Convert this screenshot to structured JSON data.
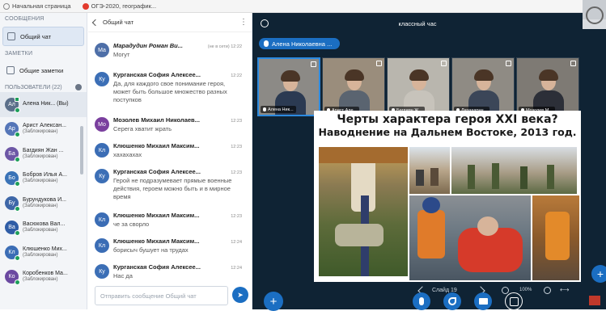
{
  "bookmarks": [
    {
      "label": "Начальная страница",
      "icon": "home-icon"
    },
    {
      "label": "ОГЭ-2020, географик...",
      "icon": "site-icon"
    }
  ],
  "sidebar": {
    "messages_section": "СООБЩЕНИЯ",
    "public_chat": "Общий чат",
    "notes_section": "ЗАМЕТКИ",
    "shared_notes": "Общие заметки",
    "users_section": "ПОЛЬЗОВАТЕЛИ (22)",
    "users": [
      {
        "initials": "Ал",
        "name": "Алена Ник... (Вы)",
        "status": "",
        "color": "#5b6f8a"
      },
      {
        "initials": "Ар",
        "name": "Арист Алексан...",
        "status": "(Заблокирован)",
        "color": "#5576b8"
      },
      {
        "initials": "Ба",
        "name": "Багдиян Жан ...",
        "status": "(Заблокирован)",
        "color": "#6d57a6"
      },
      {
        "initials": "Бо",
        "name": "Бобров Илья А...",
        "status": "(Заблокирован)",
        "color": "#3a73b7"
      },
      {
        "initials": "Бу",
        "name": "Бурундукова И...",
        "status": "(Заблокирован)",
        "color": "#3e67a8"
      },
      {
        "initials": "Ва",
        "name": "Васюкова Вал...",
        "status": "(Заблокирован)",
        "color": "#2f5da6"
      },
      {
        "initials": "Кл",
        "name": "Клюшенко Мих...",
        "status": "(Заблокирован)",
        "color": "#3b6db5"
      },
      {
        "initials": "Ко",
        "name": "Коробенков Ма...",
        "status": "(Заблокирован)",
        "color": "#6b49a1"
      }
    ]
  },
  "chat": {
    "back_label": "Общий чат",
    "more": "⋮",
    "input_placeholder": "Отправить сообщение Общий чат",
    "messages": [
      {
        "initials": "Ма",
        "color": "#4e6fa8",
        "name": "Марадудин Роман Ви...",
        "italic": true,
        "time": "(не в сети) 12:22",
        "text": "Могут"
      },
      {
        "initials": "Ку",
        "color": "#3c6fb6",
        "name": "Курганская София Алексее...",
        "italic": false,
        "time": "12:22",
        "text": "Да, для каждого свое понимание героя, может быть большое множество разных поступков"
      },
      {
        "initials": "Мо",
        "color": "#7a3f9e",
        "name": "Мозолев Михаил Николаев...",
        "italic": false,
        "time": "12:23",
        "text": "Серега хватит жрать"
      },
      {
        "initials": "Кл",
        "color": "#3b6db5",
        "name": "Клюшенко Михаил Максим...",
        "italic": false,
        "time": "12:23",
        "text": "хахахахах"
      },
      {
        "initials": "Ку",
        "color": "#3c6fb6",
        "name": "Курганская София Алексее...",
        "italic": false,
        "time": "12:23",
        "text": "Герой не подразумевает прямые военные действия, героем можно быть и в мирное время"
      },
      {
        "initials": "Кл",
        "color": "#3b6db5",
        "name": "Клюшенко Михаил Максим...",
        "italic": false,
        "time": "12:23",
        "text": "че за сворло"
      },
      {
        "initials": "Кл",
        "color": "#3b6db5",
        "name": "Клюшенко Михаил Максим...",
        "italic": false,
        "time": "12:24",
        "text": "борисыч бушует на трудах"
      },
      {
        "initials": "Ку",
        "color": "#3c6fb6",
        "name": "Курганская София Алексее...",
        "italic": false,
        "time": "12:24",
        "text": "Нас да"
      }
    ]
  },
  "meeting": {
    "title": "классный час",
    "presenter": "Алена Николаевна ...",
    "videos": [
      {
        "name": "Алена Ник...",
        "bg": "#8c8a86",
        "shirt": "#2b3a52"
      },
      {
        "name": "Арист Але...",
        "bg": "#9a8d7c",
        "shirt": "#5a6470"
      },
      {
        "name": "Багдиян Ж...",
        "bg": "#b9b6ae",
        "shirt": "#c7c3bb"
      },
      {
        "name": "Лизааарнн...",
        "bg": "#8f8b84",
        "shirt": "#3b4658"
      },
      {
        "name": "Мозолев М...",
        "bg": "#7e7a74",
        "shirt": "#2c2f38"
      }
    ],
    "slide": {
      "title_line1": "Черты характера героя XXI века?",
      "title_line2": "Наводнение на Дальнем Востоке, 2013 год."
    },
    "slide_label": "Слайд 19",
    "zoom": "100%"
  }
}
